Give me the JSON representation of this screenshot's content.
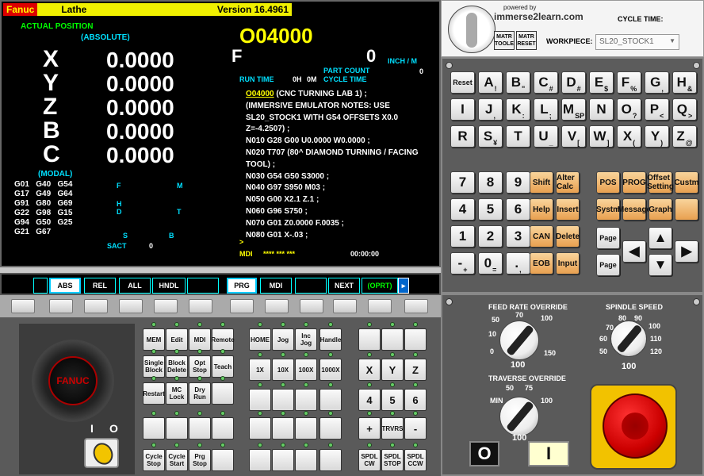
{
  "screen": {
    "brand": "Fanuc",
    "mode": "Lathe",
    "version": "Version 16.4961",
    "actual_position": "ACTUAL POSITION",
    "absolute": "(ABSOLUTE)",
    "program_no": "O04000",
    "axes": [
      {
        "name": "X",
        "value": "0.0000"
      },
      {
        "name": "Y",
        "value": "0.0000"
      },
      {
        "name": "Z",
        "value": "0.0000"
      },
      {
        "name": "B",
        "value": "0.0000"
      },
      {
        "name": "C",
        "value": "0.0000"
      }
    ],
    "f_label": "F",
    "f_value": "0",
    "inch_min": "INCH / M",
    "part_count_label": "PART COUNT",
    "part_count": "0",
    "run_time_label": "RUN TIME",
    "run_h": "0H",
    "run_m": "0M",
    "cycle_time_label": "CYCLE TIME",
    "modal_label": "(MODAL)",
    "modal_rows": [
      "G01  G40  G54",
      "G17  G49  G64",
      "G91  G80  G69",
      "G22  G98  G15",
      "G94  G50  G25",
      "G21  G67"
    ],
    "f_small": "F",
    "m_small": "M",
    "h_small": "H",
    "d_small": "D",
    "t_small": "T",
    "s_small": "S",
    "b_small": "B",
    "sact_label": "SACT",
    "sact_value": "0",
    "program_title": "O04000",
    "program_lines": [
      " (CNC TURNING LAB 1) ;",
      "(IMMERSIVE EMULATOR NOTES: USE SL20_STOCK1 WITH G54 OFFSETS X0.0 Z=-4.2507) ;",
      "N010 G28 G00 U0.0000 W0.0000 ;",
      "N020 T707 (80^ DIAMOND TURNING / FACING TOOL) ;",
      "N030 G54 G50 S3000 ;",
      "N040 G97 S950 M03 ;",
      "N050 G00 X2.1 Z.1 ;",
      "N060 G96 S750 ;",
      "N070 G01 Z0.0000 F.0035 ;",
      "N080 G01 X-.03 ;"
    ],
    "prompt": ">",
    "mdi": "MDI",
    "stars": "**** *** ***",
    "clock": "00:00:00"
  },
  "softkeys": [
    "ABS",
    "REL",
    "ALL",
    "HNDL",
    "",
    "PRG",
    "MDI",
    "",
    "NEXT",
    "(OPRT)"
  ],
  "header": {
    "powered_by": "powered by",
    "site": "immerse2learn.com",
    "cycle_time": "CYCLE TIME:",
    "workpiece_label": "WORKPIECE:",
    "workpiece_value": "SL20_STOCK1",
    "matr_tool": "MATR TOOLE",
    "matr_reset": "MATR RESET"
  },
  "keypad": {
    "row1": [
      {
        "k": "Reset"
      },
      {
        "k": "A",
        "s": "!"
      },
      {
        "k": "B",
        "s": "\""
      },
      {
        "k": "C",
        "s": "#"
      },
      {
        "k": "D",
        "s": "#"
      },
      {
        "k": "E",
        "s": "$"
      },
      {
        "k": "F",
        "s": "%"
      },
      {
        "k": "G",
        "s": ","
      },
      {
        "k": "H",
        "s": "&"
      }
    ],
    "row2": [
      {
        "k": "I"
      },
      {
        "k": "J",
        "s": ","
      },
      {
        "k": "K",
        "s": ":"
      },
      {
        "k": "L",
        "s": ";"
      },
      {
        "k": "M",
        "s": "SP"
      },
      {
        "k": "N"
      },
      {
        "k": "O",
        "s": "?"
      },
      {
        "k": "P",
        "s": "<"
      },
      {
        "k": "Q",
        "s": ">"
      }
    ],
    "row3": [
      {
        "k": "R"
      },
      {
        "k": "S",
        "s": "¥"
      },
      {
        "k": "T"
      },
      {
        "k": "U",
        "s": "_"
      },
      {
        "k": "V",
        "s": "["
      },
      {
        "k": "W",
        "s": "]"
      },
      {
        "k": "X",
        "s": "("
      },
      {
        "k": "Y",
        "s": ")"
      },
      {
        "k": "Z",
        "s": "@"
      }
    ],
    "num": [
      [
        "7",
        "8",
        "9"
      ],
      [
        "4",
        "5",
        "6"
      ],
      [
        "1",
        "2",
        "3"
      ],
      [
        "-",
        "0",
        "."
      ]
    ],
    "num_sub": [
      "+",
      "=",
      ","
    ],
    "fn": [
      [
        "Shift",
        "Alter Calc"
      ],
      [
        "Help",
        "Insert"
      ],
      [
        "CAN",
        "Delete"
      ],
      [
        "EOB",
        "Input"
      ]
    ],
    "mode": [
      [
        "POS",
        "PROG",
        "Offset Setting",
        "Custm"
      ],
      [
        "Systm",
        "Message",
        "Graph",
        ""
      ]
    ],
    "page_up": "Page",
    "page_down": "Page"
  },
  "ops": {
    "mode_keys": [
      "MEM",
      "Edit",
      "MDI",
      "Remote"
    ],
    "row2": [
      "Single Block",
      "Block Delete",
      "Opt Stop",
      "Teach"
    ],
    "row3": [
      "Restart",
      "MC Lock",
      "Dry Run",
      ""
    ],
    "row5": [
      "Cycle Stop",
      "Cycle Start",
      "Prg Stop",
      ""
    ],
    "jog": [
      "HOME",
      "Jog",
      "Inc Jog",
      "Handle"
    ],
    "mult": [
      "1X",
      "10X",
      "100X",
      "1000X"
    ],
    "xyz": [
      "X",
      "Y",
      "Z"
    ],
    "n456": [
      "4",
      "5",
      "6"
    ],
    "trv": [
      "+",
      "TRVRS",
      "-"
    ],
    "spdl": [
      "SPDL CW",
      "SPDL STOP",
      "SPDL CCW"
    ],
    "wheel": "FANUC",
    "i_lbl": "I",
    "o_lbl": "O"
  },
  "right": {
    "feed_title": "FEED RATE OVERRIDE",
    "feed_ticks": [
      "50",
      "70",
      "100",
      "150",
      "100",
      "10",
      "0"
    ],
    "spindle_title": "SPINDLE SPEED",
    "spin_ticks": [
      "70",
      "80",
      "90",
      "100",
      "60",
      "110",
      "50",
      "120",
      "100"
    ],
    "trav_title": "TRAVERSE OVERRIDE",
    "trav_ticks": [
      "50",
      "75",
      "MIN",
      "100",
      "100"
    ],
    "btn_o": "O",
    "btn_i": "I"
  }
}
